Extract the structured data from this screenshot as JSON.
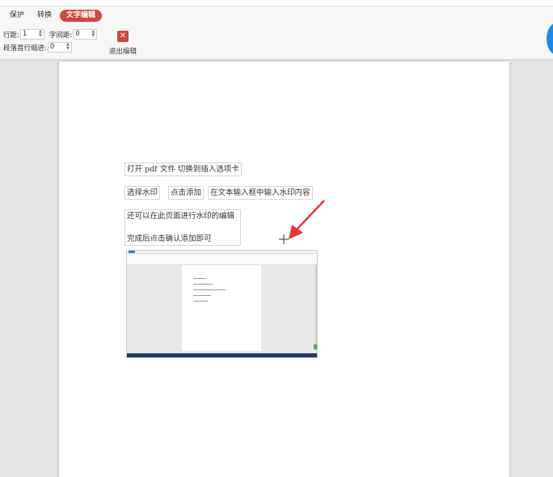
{
  "toolbar": {
    "tabs": [
      {
        "label": "保护",
        "active": false
      },
      {
        "label": "转换",
        "active": false
      },
      {
        "label": "文字编辑",
        "active": true
      }
    ],
    "line_spacing": {
      "label": "行距:",
      "value": "1"
    },
    "char_spacing": {
      "label": "字间距:",
      "value": "0"
    },
    "first_indent": {
      "label": "段落首行缩进:",
      "value": "0"
    },
    "exit": {
      "label": "退出编辑",
      "icon": "close-icon"
    }
  },
  "document": {
    "boxes": [
      {
        "text": "打开 pdf 文件   切换到插入选项卡"
      },
      {
        "text": "选择水印"
      },
      {
        "text": "点击添加"
      },
      {
        "text": "在文本输入框中输入水印内容"
      },
      {
        "text": "还可以在此页面进行水印的编辑"
      },
      {
        "text": "完成后点击确认添加即可"
      }
    ]
  },
  "colors": {
    "accent": "#d2463f",
    "annotation_arrow": "#e53935",
    "background": "#e3e3e3"
  }
}
